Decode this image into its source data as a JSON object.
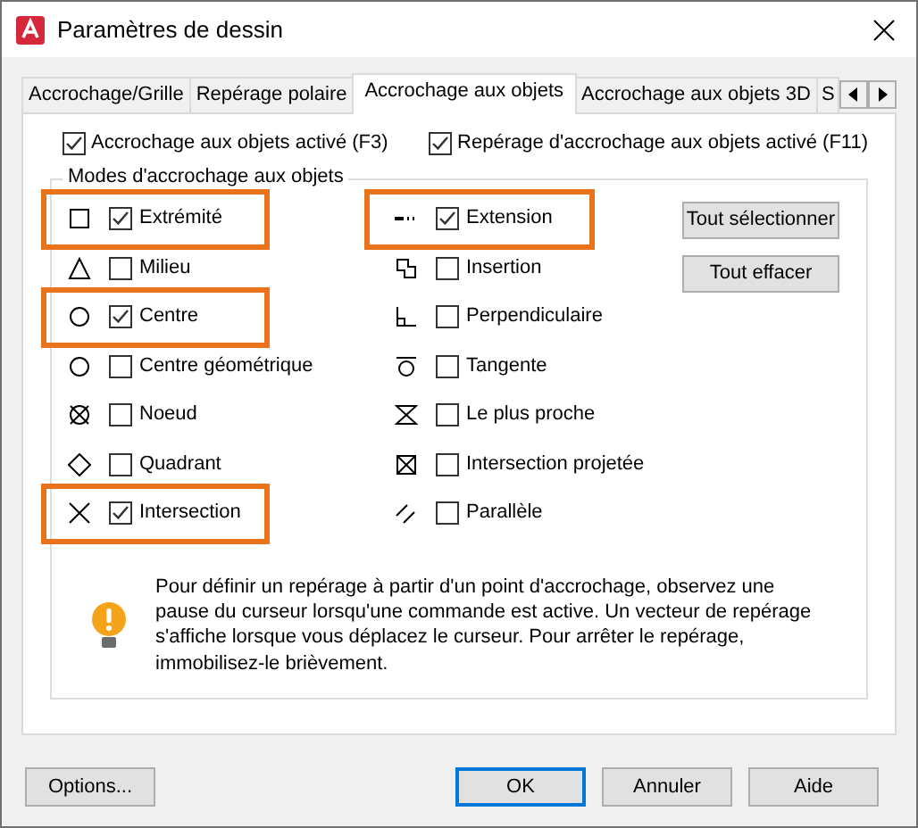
{
  "window": {
    "title": "Paramètres de dessin"
  },
  "tabs": [
    {
      "label": "Accrochage/Grille",
      "selected": false
    },
    {
      "label": "Repérage polaire",
      "selected": false
    },
    {
      "label": "Accrochage aux objets",
      "selected": true
    },
    {
      "label": "Accrochage aux objets 3D",
      "selected": false
    },
    {
      "label": "S",
      "selected": false
    }
  ],
  "options": [
    {
      "label": "Accrochage aux objets activé (F3)",
      "checked": true
    },
    {
      "label": "Repérage d'accrochage aux objets activé (F11)",
      "checked": true
    }
  ],
  "modes_group": {
    "title": "Modes d'accrochage aux objets",
    "left": [
      {
        "label": "Extrémité",
        "checked": true,
        "highlighted": true
      },
      {
        "label": "Milieu",
        "checked": false,
        "highlighted": false
      },
      {
        "label": "Centre",
        "checked": true,
        "highlighted": true
      },
      {
        "label": "Centre géométrique",
        "checked": false,
        "highlighted": false
      },
      {
        "label": "Noeud",
        "checked": false,
        "highlighted": false
      },
      {
        "label": "Quadrant",
        "checked": false,
        "highlighted": false
      },
      {
        "label": "Intersection",
        "checked": true,
        "highlighted": true
      }
    ],
    "right": [
      {
        "label": "Extension",
        "checked": true,
        "highlighted": true
      },
      {
        "label": "Insertion",
        "checked": false,
        "highlighted": false
      },
      {
        "label": "Perpendiculaire",
        "checked": false,
        "highlighted": false
      },
      {
        "label": "Tangente",
        "checked": false,
        "highlighted": false
      },
      {
        "label": "Le plus proche",
        "checked": false,
        "highlighted": false
      },
      {
        "label": "Intersection projetée",
        "checked": false,
        "highlighted": false
      },
      {
        "label": "Parallèle",
        "checked": false,
        "highlighted": false
      }
    ],
    "buttons": [
      "Tout sélectionner",
      "Tout effacer"
    ],
    "tip": "Pour définir un repérage à partir d'un point d'accrochage, observez une pause du curseur lorsqu'une commande est active. Un vecteur de repérage s'affiche lorsque vous déplacez le curseur. Pour arrêter le repérage, immobilisez-le brièvement."
  },
  "footer": [
    {
      "label": "Options...",
      "default": false
    },
    {
      "label": "OK",
      "default": true
    },
    {
      "label": "Annuler",
      "default": false
    },
    {
      "label": "Aide",
      "default": false
    }
  ]
}
